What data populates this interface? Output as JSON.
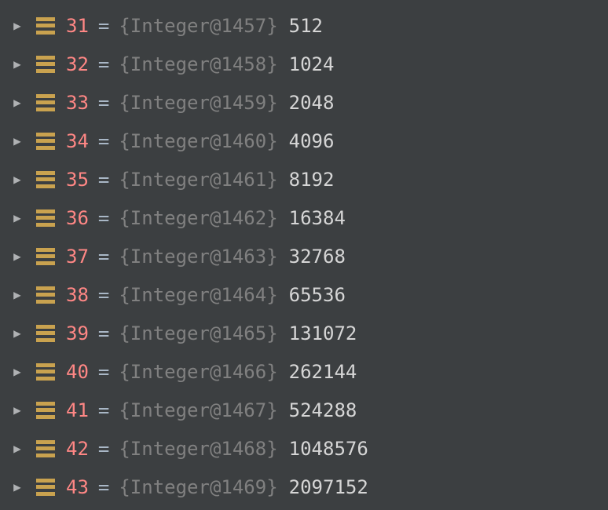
{
  "equals": "=",
  "rows": [
    {
      "index": "31",
      "type": "{Integer@1457}",
      "value": "512"
    },
    {
      "index": "32",
      "type": "{Integer@1458}",
      "value": "1024"
    },
    {
      "index": "33",
      "type": "{Integer@1459}",
      "value": "2048"
    },
    {
      "index": "34",
      "type": "{Integer@1460}",
      "value": "4096"
    },
    {
      "index": "35",
      "type": "{Integer@1461}",
      "value": "8192"
    },
    {
      "index": "36",
      "type": "{Integer@1462}",
      "value": "16384"
    },
    {
      "index": "37",
      "type": "{Integer@1463}",
      "value": "32768"
    },
    {
      "index": "38",
      "type": "{Integer@1464}",
      "value": "65536"
    },
    {
      "index": "39",
      "type": "{Integer@1465}",
      "value": "131072"
    },
    {
      "index": "40",
      "type": "{Integer@1466}",
      "value": "262144"
    },
    {
      "index": "41",
      "type": "{Integer@1467}",
      "value": "524288"
    },
    {
      "index": "42",
      "type": "{Integer@1468}",
      "value": "1048576"
    },
    {
      "index": "43",
      "type": "{Integer@1469}",
      "value": "2097152"
    }
  ]
}
